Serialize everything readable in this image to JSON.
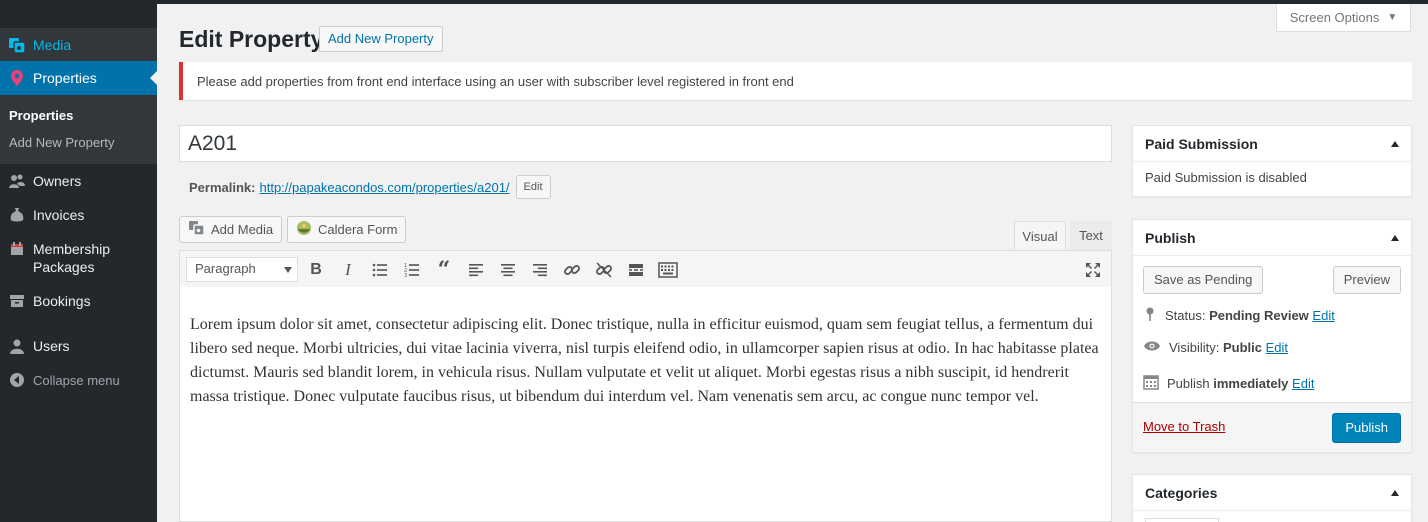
{
  "sidebar": {
    "items": [
      {
        "label": "Media",
        "icon": "media-icon"
      },
      {
        "label": "Properties",
        "icon": "pin-icon"
      },
      {
        "label": "Owners",
        "icon": "groups-icon"
      },
      {
        "label": "Invoices",
        "icon": "money-bag-icon"
      },
      {
        "label": "Membership Packages",
        "icon": "calendar-icon"
      },
      {
        "label": "Bookings",
        "icon": "archive-icon"
      },
      {
        "label": "Users",
        "icon": "user-icon"
      },
      {
        "label": "Collapse menu",
        "icon": "collapse-icon"
      }
    ],
    "submenu": [
      "Properties",
      "Add New Property"
    ]
  },
  "header": {
    "title": "Edit Property",
    "add_new_label": "Add New Property",
    "screen_options": "Screen Options"
  },
  "notice": "Please add properties from front end interface using an user with subscriber level registered in front end",
  "post": {
    "title": "A201",
    "permalink_label": "Permalink:",
    "permalink_url": "http://papakeacondos.com/properties/a201/",
    "edit_label": "Edit"
  },
  "editor": {
    "add_media": "Add Media",
    "caldera_form": "Caldera Form",
    "tab_visual": "Visual",
    "tab_text": "Text",
    "format": "Paragraph",
    "content": "Lorem ipsum dolor sit amet, consectetur adipiscing elit. Donec tristique, nulla in efficitur euismod, quam sem feugiat tellus, a fermentum dui libero sed neque. Morbi ultricies, dui vitae lacinia viverra, nisl turpis eleifend odio, in ullamcorper sapien risus at odio. In hac habitasse platea dictumst. Mauris sed blandit lorem, in vehicula risus. Nullam vulputate et velit ut aliquet. Morbi egestas risus a nibh suscipit, id hendrerit massa tristique. Donec vulputate faucibus risus, ut bibendum dui interdum vel. Nam venenatis sem arcu, ac congue nunc tempor vel."
  },
  "paid_submission": {
    "title": "Paid Submission",
    "text": "Paid Submission is disabled"
  },
  "publish": {
    "title": "Publish",
    "save_pending": "Save as Pending",
    "preview": "Preview",
    "status_label": "Status:",
    "status_value": "Pending Review",
    "visibility_label": "Visibility:",
    "visibility_value": "Public",
    "publish_label": "Publish",
    "publish_value": "immediately",
    "edit": "Edit",
    "trash": "Move to Trash",
    "publish_button": "Publish"
  },
  "categories": {
    "title": "Categories"
  },
  "colors": {
    "sidebar_bg": "#23282d",
    "accent": "#0073aa",
    "primary_button": "#0085ba",
    "notice_border": "#dc3232",
    "trash_link": "#a00"
  }
}
